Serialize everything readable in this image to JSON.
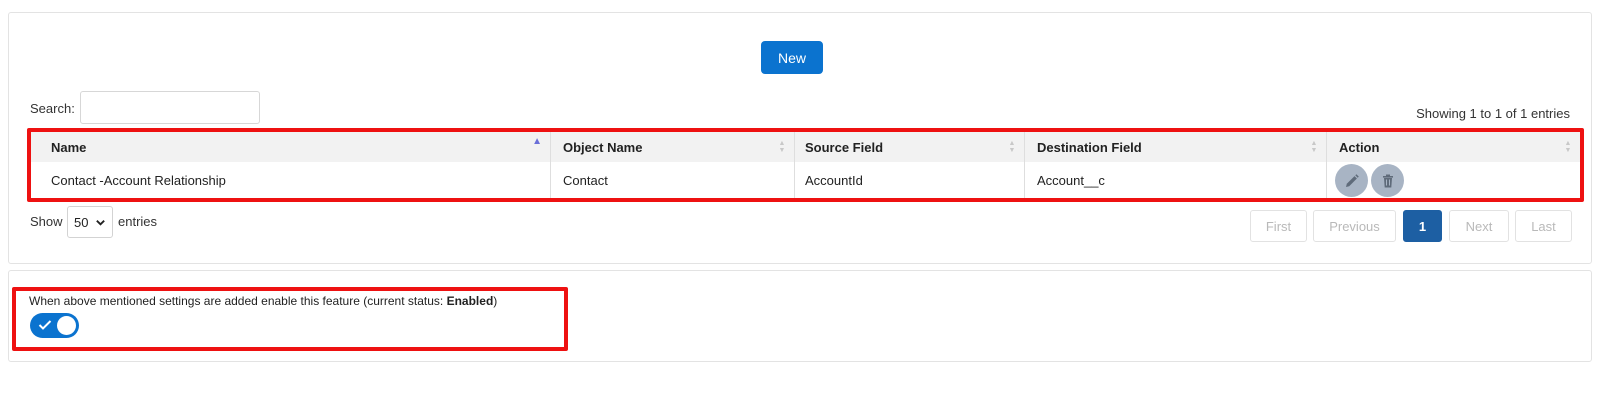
{
  "toolbar": {
    "new_label": "New"
  },
  "search": {
    "label": "Search:",
    "value": ""
  },
  "summary": {
    "showing": "Showing 1 to 1 of 1 entries"
  },
  "table": {
    "columns": [
      "Name",
      "Object Name",
      "Source Field",
      "Destination Field",
      "Action"
    ],
    "rows": [
      {
        "name": "Contact -Account Relationship",
        "object_name": "Contact",
        "source_field": "AccountId",
        "destination_field": "Account__c"
      }
    ],
    "sorted_column": "Name",
    "sort_direction": "ascending"
  },
  "length": {
    "show_label": "Show",
    "value": "50",
    "entries_label": "entries"
  },
  "pagination": {
    "first": "First",
    "previous": "Previous",
    "current": "1",
    "next": "Next",
    "last": "Last"
  },
  "feature": {
    "text_prefix": "When above mentioned settings are added enable this feature (current status: ",
    "status": "Enabled",
    "text_suffix": ")",
    "toggle_on": true
  },
  "colors": {
    "accent": "#0b73cf",
    "highlight_border": "#ee1111",
    "pagination_active": "#1d5fa3",
    "action_icon_bg": "#a8b4c4"
  },
  "icons": {
    "edit": "pencil-icon",
    "delete": "trash-icon",
    "check": "check-icon",
    "chevron": "chevron-down-icon"
  }
}
